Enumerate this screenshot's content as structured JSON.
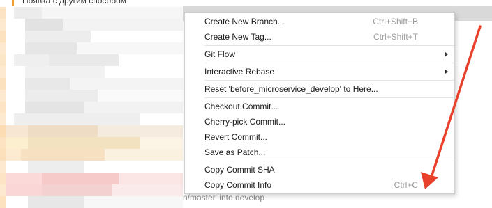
{
  "background": {
    "top_commit_message": "Появка с другим способом",
    "bottom_commit_message": "n/master' into develop"
  },
  "context_menu": {
    "items": [
      {
        "label": "Create New Branch...",
        "shortcut": "Ctrl+Shift+B"
      },
      {
        "label": "Create New Tag...",
        "shortcut": "Ctrl+Shift+T"
      },
      {
        "label": "Git Flow",
        "has_submenu": true
      },
      {
        "label": "Interactive Rebase",
        "has_submenu": true
      },
      {
        "label": "Reset 'before_microservice_develop' to Here..."
      },
      {
        "label": "Checkout Commit..."
      },
      {
        "label": "Cherry-pick Commit..."
      },
      {
        "label": "Revert Commit..."
      },
      {
        "label": "Save as Patch..."
      },
      {
        "label": "Copy Commit SHA"
      },
      {
        "label": "Copy Commit Info",
        "shortcut": "Ctrl+C"
      }
    ]
  },
  "colors": {
    "annotation_arrow": "#e8402a",
    "branch_line": "#f0a030",
    "selection": "#d9d9d9"
  }
}
